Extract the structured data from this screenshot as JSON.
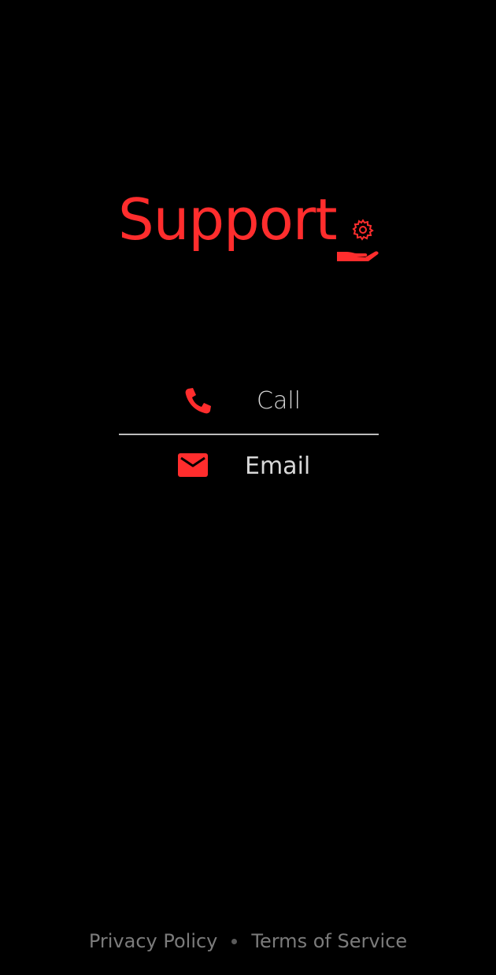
{
  "page": {
    "title": "Support",
    "accent_color": "#ff2d2d",
    "background_color": "#000000"
  },
  "header": {
    "title": "Support",
    "icon": "hand-gear-icon"
  },
  "contact_options": [
    {
      "label": "Call",
      "icon": "phone-icon"
    },
    {
      "label": "Email",
      "icon": "envelope-icon"
    }
  ],
  "footer": {
    "privacy_label": "Privacy Policy",
    "terms_label": "Terms of Service"
  }
}
